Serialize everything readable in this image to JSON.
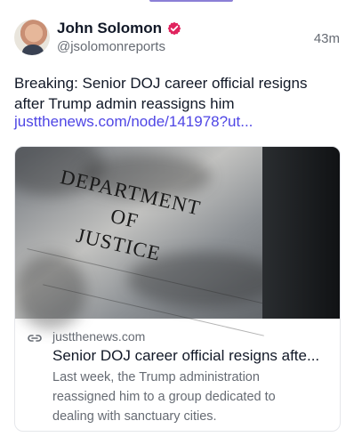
{
  "author": {
    "name": "John Solomon",
    "handle": "@jsolomonreports",
    "time": "43m"
  },
  "post": {
    "text": "Breaking: Senior DOJ career official resigns after Trump admin reassigns him",
    "link": "justthenews.com/node/141978?ut..."
  },
  "card": {
    "image_text": [
      "DEPARTMENT",
      "OF",
      "JUSTICE"
    ],
    "domain": "justthenews.com",
    "title": "Senior DOJ career official resigns afte...",
    "description": "Last week, the Trump administration reassigned him to a group dedicated to dealing with sanctuary cities."
  },
  "icons": {
    "verified": "verified-badge-icon",
    "link": "link-icon"
  },
  "colors": {
    "accent": "#4f46e5",
    "verified": "#e0245e",
    "muted": "#666b73"
  }
}
